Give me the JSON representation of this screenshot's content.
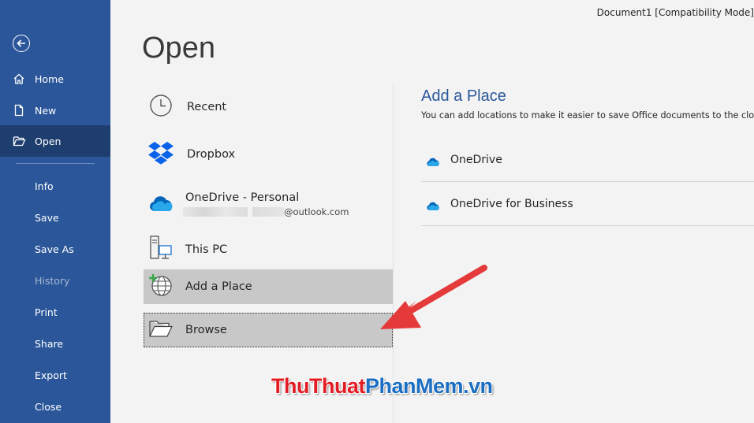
{
  "window": {
    "document_title": "Document1 [Compatibility Mode]"
  },
  "page": {
    "title": "Open"
  },
  "sidebar": {
    "items": [
      {
        "label": "Home"
      },
      {
        "label": "New"
      },
      {
        "label": "Open"
      },
      {
        "label": "Info"
      },
      {
        "label": "Save"
      },
      {
        "label": "Save As"
      },
      {
        "label": "History"
      },
      {
        "label": "Print"
      },
      {
        "label": "Share"
      },
      {
        "label": "Export"
      },
      {
        "label": "Close"
      }
    ]
  },
  "locations": {
    "recent": "Recent",
    "dropbox": "Dropbox",
    "onedrive_personal": "OneDrive - Personal",
    "onedrive_email": "@outlook.com",
    "this_pc": "This PC",
    "add_place": "Add a Place",
    "browse": "Browse"
  },
  "add_place_panel": {
    "title": "Add a Place",
    "description": "You can add locations to make it easier to save Office documents to the cloud.",
    "items": [
      {
        "label": "OneDrive"
      },
      {
        "label": "OneDrive for Business"
      }
    ]
  },
  "watermark": {
    "part1": "ThuThuat",
    "part2": "PhanMem",
    "part3": ".vn"
  },
  "colors": {
    "sidebar": "#2b579a",
    "sidebar_active": "#1e3e6f",
    "accent": "#2b579a",
    "arrow": "#e53a3a",
    "selected": "#c8c8c8"
  }
}
